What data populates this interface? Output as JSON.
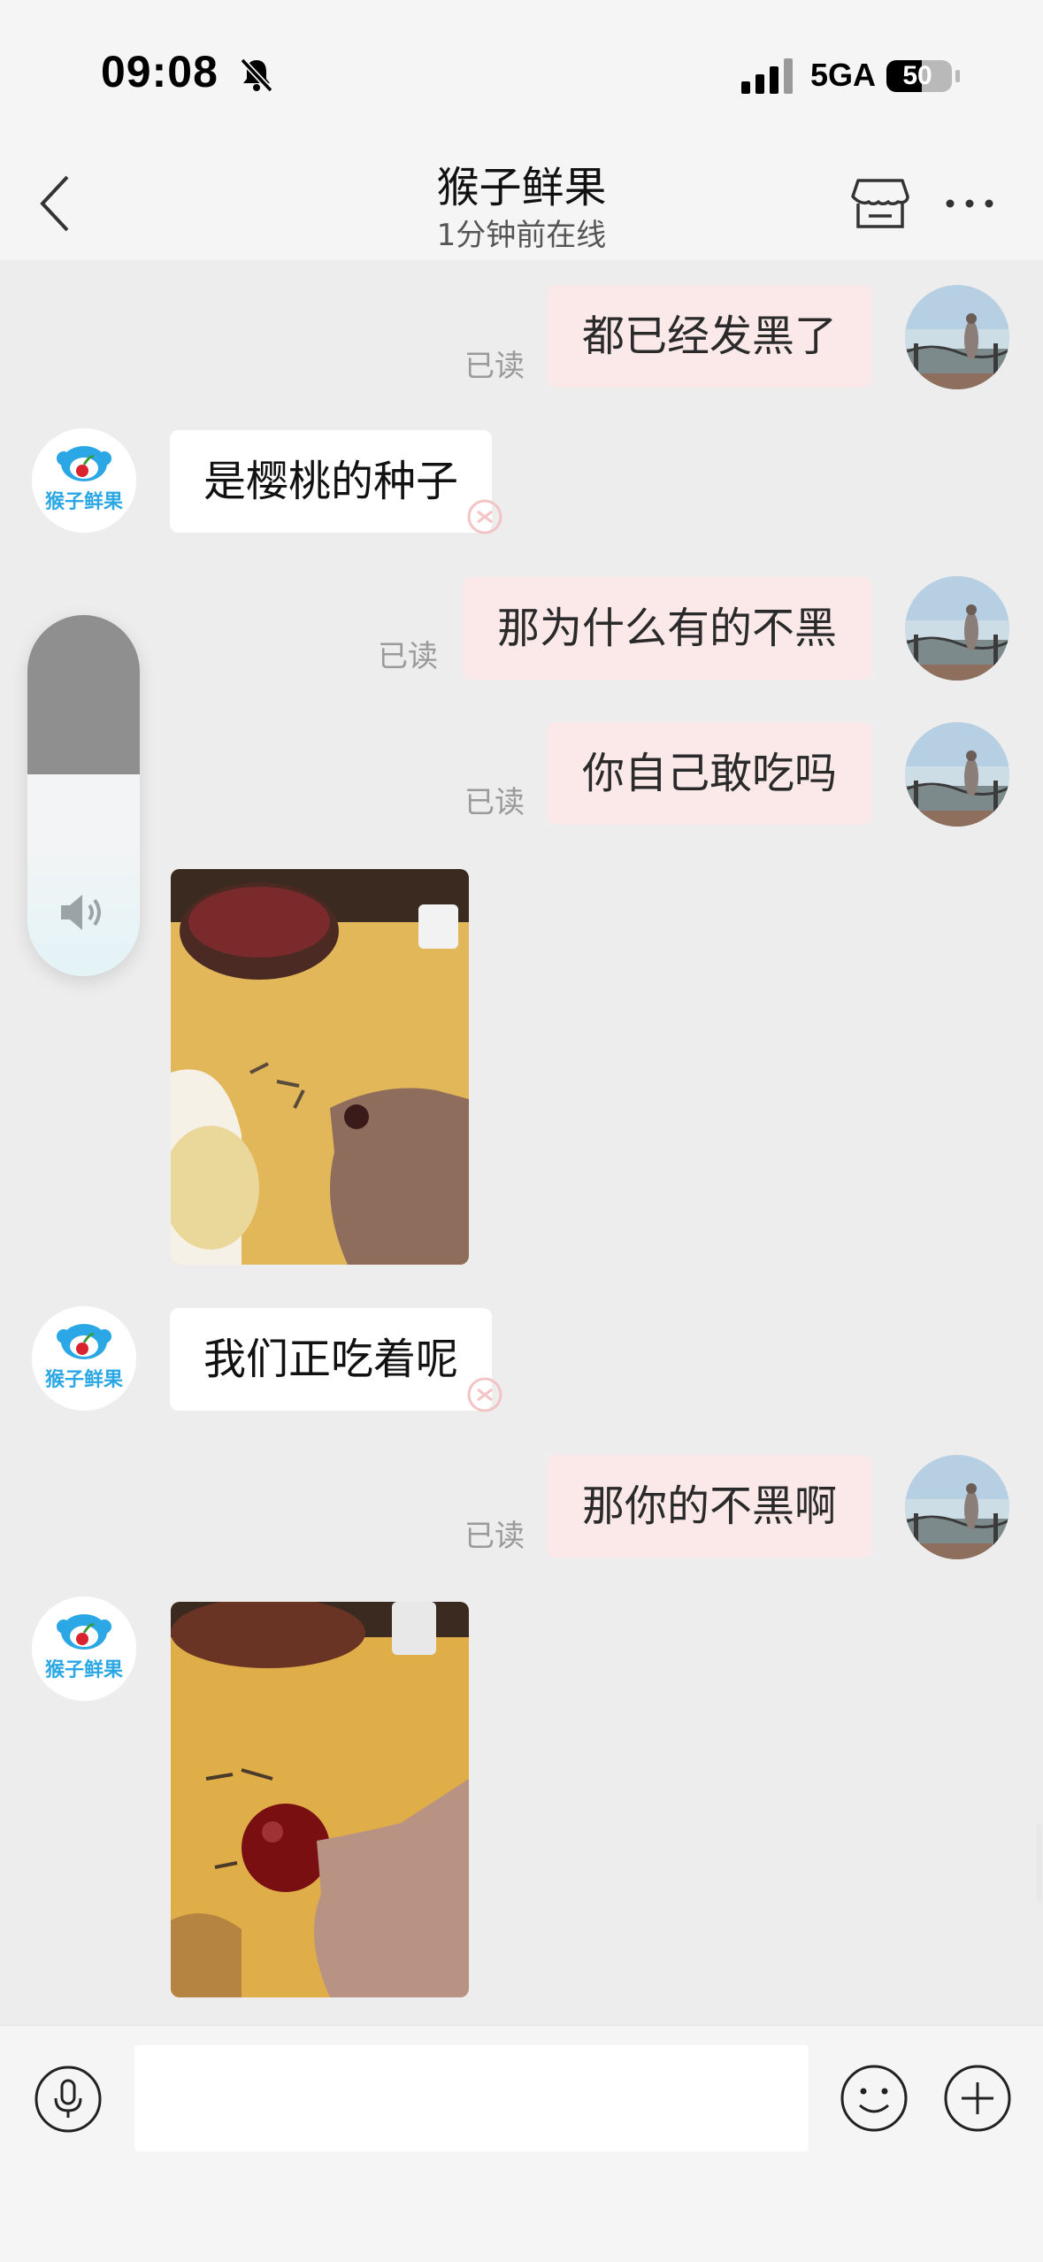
{
  "status_bar": {
    "time": "09:08",
    "network": "5GA",
    "battery": "50"
  },
  "header": {
    "title": "猴子鲜果",
    "subtitle": "1分钟前在线"
  },
  "shop": {
    "logo_text": "猴子鲜果",
    "brand_color": "#2aa7e4"
  },
  "messages": [
    {
      "from": "me",
      "text": "都已经发黑了",
      "status": "已读"
    },
    {
      "from": "shop",
      "text": "是樱桃的种子"
    },
    {
      "from": "me",
      "text": "那为什么有的不黑",
      "status": "已读"
    },
    {
      "from": "me",
      "text": "你自己敢吃吗",
      "status": "已读"
    },
    {
      "from": "shop",
      "type": "image",
      "alt": "photo of cherries on table"
    },
    {
      "from": "shop",
      "text": "我们正吃着呢"
    },
    {
      "from": "me",
      "text": "那你的不黑啊",
      "status": "已读"
    },
    {
      "from": "shop",
      "type": "image",
      "alt": "photo of cherry held in hand"
    }
  ],
  "volume": {
    "level": 0.56,
    "icon": "speaker-icon"
  },
  "input": {
    "placeholder": "",
    "value": ""
  },
  "colors": {
    "outgoing_bubble": "#fbe9ea",
    "incoming_bubble": "#ffffff",
    "background": "#ededed"
  }
}
